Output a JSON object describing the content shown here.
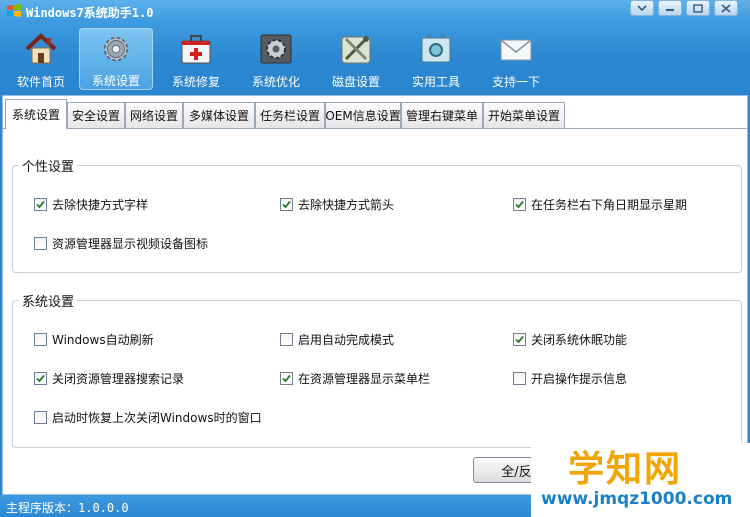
{
  "window": {
    "title": "Windows7系统助手1.0",
    "controls": {
      "menu": "▾",
      "minimize": "—",
      "maximize": "□",
      "close": "✕"
    }
  },
  "toolbar": {
    "items": [
      {
        "label": "软件首页",
        "icon": "house-icon",
        "active": false
      },
      {
        "label": "系统设置",
        "icon": "gear-icon",
        "active": true
      },
      {
        "label": "系统修复",
        "icon": "first-aid-kit-icon",
        "active": false
      },
      {
        "label": "系统优化",
        "icon": "cog-box-icon",
        "active": false
      },
      {
        "label": "磁盘设置",
        "icon": "disk-tools-icon",
        "active": false
      },
      {
        "label": "实用工具",
        "icon": "toolbox-icon",
        "active": false
      },
      {
        "label": "支持一下",
        "icon": "envelope-icon",
        "active": false
      }
    ]
  },
  "tabs": [
    "系统设置",
    "安全设置",
    "网络设置",
    "多媒体设置",
    "任务栏设置",
    "OEM信息设置",
    "管理右键菜单",
    "开始菜单设置"
  ],
  "active_tab": "系统设置",
  "personalize": {
    "title": "个性设置",
    "options": [
      {
        "label": "去除快捷方式字样",
        "checked": true
      },
      {
        "label": "去除快捷方式箭头",
        "checked": true
      },
      {
        "label": "在任务栏右下角日期显示星期",
        "checked": true
      },
      {
        "label": "资源管理器显示视频设备图标",
        "checked": false
      }
    ]
  },
  "system": {
    "title": "系统设置",
    "options": [
      {
        "label": "Windows自动刷新",
        "checked": false
      },
      {
        "label": "启用自动完成模式",
        "checked": false
      },
      {
        "label": "关闭系统休眠功能",
        "checked": true
      },
      {
        "label": "关闭资源管理器搜索记录",
        "checked": true
      },
      {
        "label": "在资源管理器显示菜单栏",
        "checked": true
      },
      {
        "label": "开启操作提示信息",
        "checked": false
      },
      {
        "label": "启动时恢复上次关闭Windows时的窗口",
        "checked": false
      }
    ]
  },
  "buttons": {
    "select_toggle": "全/反选"
  },
  "watermark": {
    "big": "学知网",
    "small": "www.jmqz1000.com"
  },
  "status": {
    "text": "主程序版本：1.0.0.0"
  },
  "colors": {
    "accent": "#2a86cf",
    "check": "#2a7a2a",
    "watermark_orange": "#f2a400"
  }
}
